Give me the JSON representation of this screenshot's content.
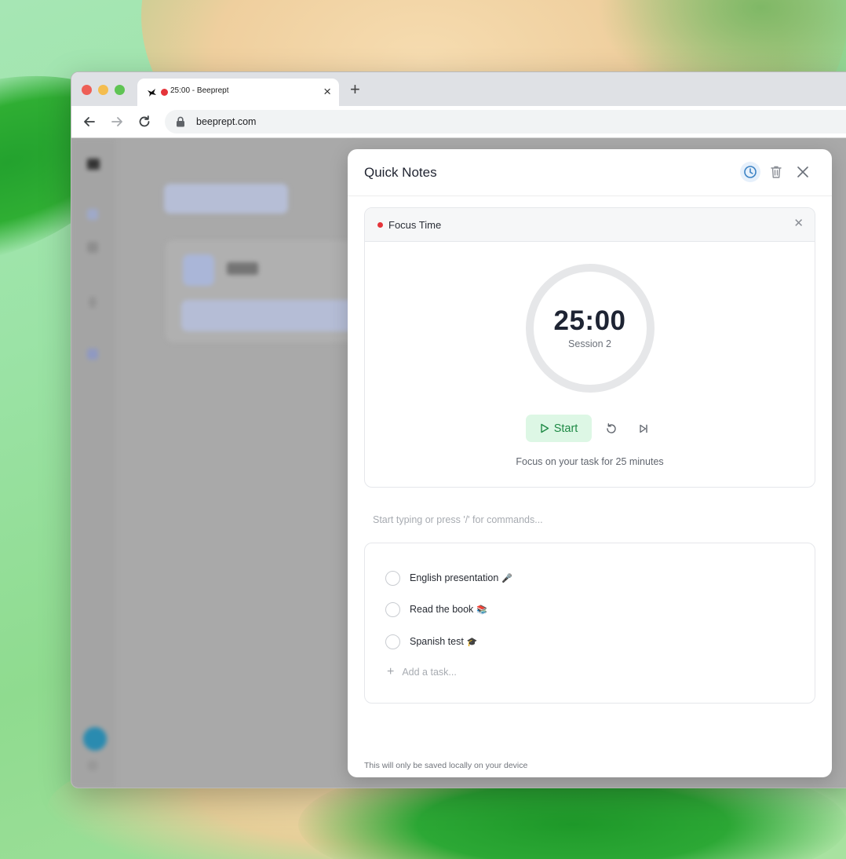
{
  "browser": {
    "tab": {
      "title": "25:00 - Beeprept",
      "favicon": "bee-logo-icon",
      "recording": true
    },
    "url": "beeprept.com"
  },
  "quick_notes": {
    "title": "Quick Notes",
    "header_icons": [
      "clock-icon",
      "trash-icon",
      "close-icon"
    ],
    "timer": {
      "label": "Focus Time",
      "time": "25:00",
      "session": "Session 2",
      "progress": 0,
      "start_label": "Start",
      "hint": "Focus on your task for 25 minutes"
    },
    "editor_placeholder": "Start typing or press '/' for commands...",
    "tasks": [
      {
        "label": "English presentation",
        "emoji": "🎤",
        "done": false
      },
      {
        "label": "Read the book",
        "emoji": "📚",
        "done": false
      },
      {
        "label": "Spanish test",
        "emoji": "🎓",
        "done": false
      }
    ],
    "add_task_placeholder": "Add a task...",
    "footer": "This will only be saved locally on your device"
  },
  "colors": {
    "accent_green": "#1f8a46",
    "start_bg": "#ddf7e5",
    "record_red": "#e5343a",
    "clock_blue": "#3b82c4"
  }
}
